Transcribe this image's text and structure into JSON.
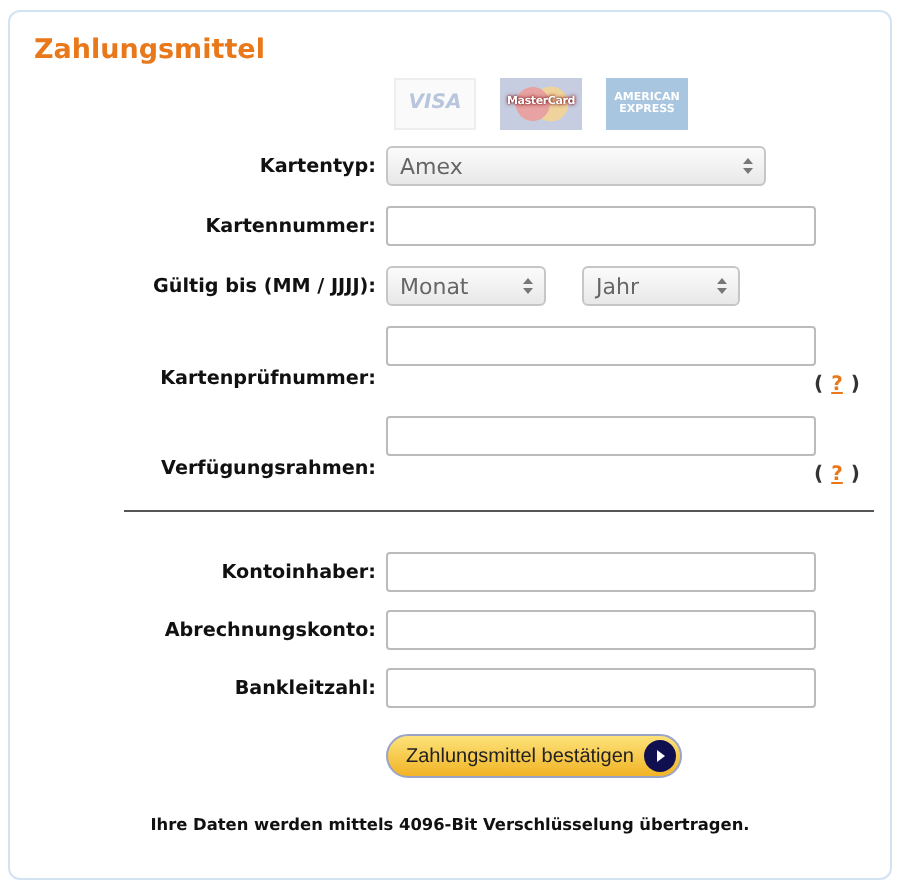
{
  "title": "Zahlungsmittel",
  "card_logos": [
    {
      "kind": "visa",
      "label": "VISA"
    },
    {
      "kind": "mastercard",
      "label": "MasterCard"
    },
    {
      "kind": "amex",
      "label": "AMERICAN EXPRESS"
    }
  ],
  "sections": [
    [
      {
        "kind": "select",
        "label": "Kartentyp:",
        "value": "Amex"
      },
      {
        "kind": "input",
        "label": "Kartennummer:"
      },
      {
        "kind": "date",
        "label": "Gültig bis (MM / JJJJ):",
        "selects": [
          "Monat",
          "Jahr"
        ]
      },
      {
        "kind": "input",
        "label": "Kartenprüfnummer:",
        "help": {
          "open": "(",
          "link": "?",
          "close": ")"
        }
      },
      {
        "kind": "input",
        "label": "Verfügungsrahmen:",
        "help": {
          "open": "(",
          "link": "?",
          "close": ")"
        }
      }
    ],
    [
      {
        "kind": "input",
        "label": "Kontoinhaber:"
      },
      {
        "kind": "input",
        "label": "Abrechnungskonto:"
      },
      {
        "kind": "input",
        "label": "Bankleitzahl:"
      }
    ]
  ],
  "submit_button": "Zahlungsmittel bestätigen",
  "note": "Ihre Daten werden mittels 4096-Bit Verschlüsselung übertragen."
}
